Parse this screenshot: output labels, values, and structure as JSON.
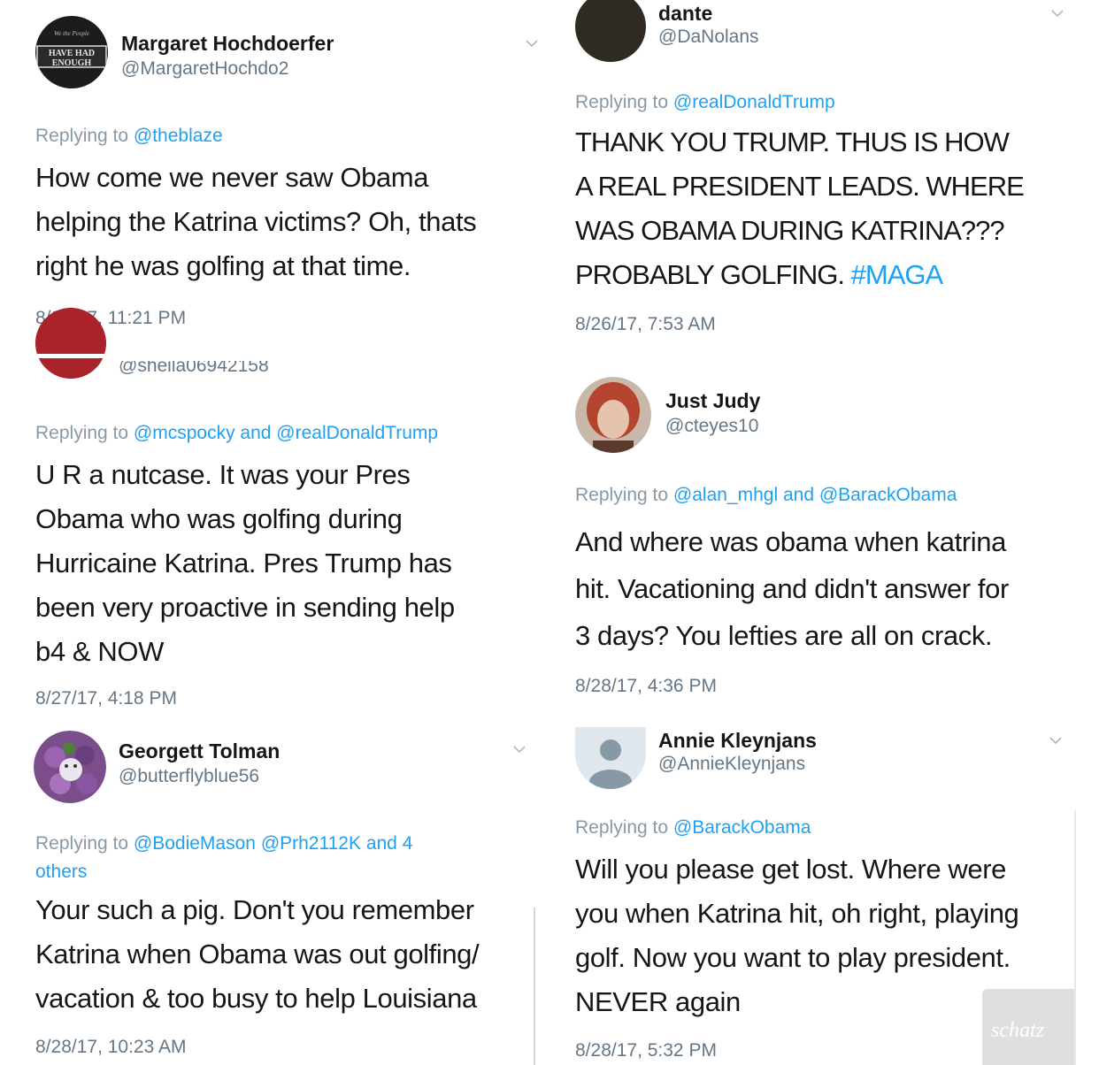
{
  "tweets": [
    {
      "name": "Margaret Hochdoerfer",
      "handle": "@MargaretHochdo2",
      "avatar_text": "HAVE HAD ENOUGH",
      "reply_prefix": "Replying to ",
      "mention1": "@theblaze",
      "body": [
        "How come we never saw Obama",
        "helping the Katrina victims? Oh, thats",
        "right he was golfing at that time."
      ],
      "time": "8/26/17, 11:21 PM"
    },
    {
      "handle": "@sheila06942158",
      "reply_prefix": "Replying to ",
      "mention1": "@mcspocky",
      "joiner": " and ",
      "mention2": "@realDonaldTrump",
      "body": [
        "U R a nutcase. It was your Pres",
        "Obama who was golfing during",
        "Hurricaine Katrina. Pres Trump has",
        "been very proactive in sending help",
        "b4 & NOW"
      ],
      "time": "8/27/17, 4:18 PM"
    },
    {
      "name": "Georgett Tolman",
      "handle": "@butterflyblue56",
      "reply_prefix": "Replying to ",
      "mention1": "@BodieMason",
      "mention2": "@Prh2112K",
      "joiner": " and 4",
      "others": "others",
      "body": [
        "Your such a pig. Don't you remember",
        "Katrina when Obama was out golfing/",
        "vacation & too busy to help Louisiana"
      ],
      "time": "8/28/17, 10:23 AM"
    },
    {
      "name": "dante",
      "handle": "@DaNolans",
      "reply_prefix": "Replying to ",
      "mention1": "@realDonaldTrump",
      "body": [
        "THANK YOU TRUMP.  THUS IS HOW",
        "A REAL PRESIDENT LEADS.  WHERE",
        "WAS OBAMA DURING KATRINA???",
        "PROBABLY GOLFING. "
      ],
      "hashtag": "#MAGA",
      "time": "8/26/17, 7:53 AM"
    },
    {
      "name": "Just Judy",
      "handle": "@cteyes10",
      "reply_prefix": "Replying to ",
      "mention1": "@alan_mhgl",
      "joiner": " and ",
      "mention2": "@BarackObama",
      "body": [
        "And where was obama when katrina",
        "hit. Vacationing and didn't answer for",
        "3 days? You lefties are all on crack."
      ],
      "time": "8/28/17, 4:36 PM"
    },
    {
      "name": "Annie Kleynjans",
      "handle": "@AnnieKleynjans",
      "reply_prefix": "Replying to ",
      "mention1": "@BarackObama",
      "body": [
        "Will you please get lost.  Where were",
        "you when Katrina hit, oh right, playing",
        "golf. Now you want to play president.",
        "NEVER again"
      ],
      "time": "8/28/17, 5:32 PM"
    }
  ],
  "watermark": "schatz",
  "colors": {
    "link": "#1da1f2",
    "muted": "#657786",
    "text": "#14171a"
  },
  "icons": {
    "menu": "chevron-down-icon",
    "avatar_default": "default-avatar-icon"
  }
}
